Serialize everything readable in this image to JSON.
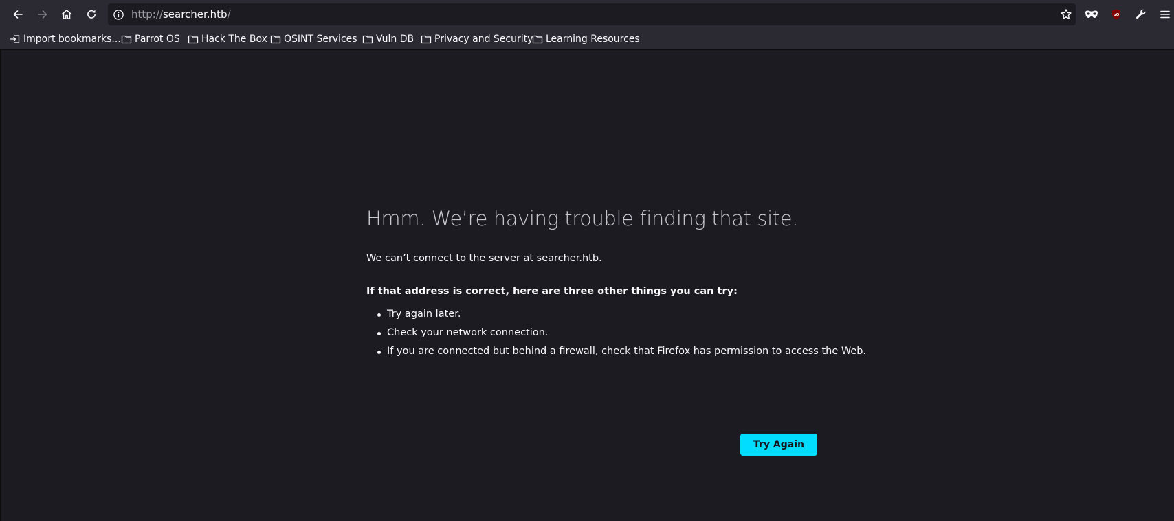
{
  "browser": {
    "url": {
      "scheme": "http://",
      "host": "searcher.htb",
      "path": "/"
    },
    "toolbar_icons": [
      "back-arrow-icon",
      "forward-arrow-icon",
      "home-icon",
      "reload-icon",
      "info-icon",
      "star-icon",
      "private-mask-icon",
      "ublock-icon",
      "wrench-icon",
      "hamburger-menu-icon"
    ],
    "accent_color": "#00ddff"
  },
  "bookmarks": [
    {
      "label": "Import bookmarks...",
      "icon": "import-icon"
    },
    {
      "label": "Parrot OS",
      "icon": "folder-icon"
    },
    {
      "label": "Hack The Box",
      "icon": "folder-icon"
    },
    {
      "label": "OSINT Services",
      "icon": "folder-icon"
    },
    {
      "label": "Vuln DB",
      "icon": "folder-icon"
    },
    {
      "label": "Privacy and Security",
      "icon": "folder-icon"
    },
    {
      "label": "Learning Resources",
      "icon": "folder-icon"
    }
  ],
  "error": {
    "title": "Hmm. We’re having trouble finding that site.",
    "description": "We can’t connect to the server at searcher.htb.",
    "intro": "If that address is correct, here are three other things you can try:",
    "suggestions": [
      "Try again later.",
      "Check your network connection.",
      "If you are connected but behind a firewall, check that Firefox has permission to access the Web."
    ],
    "button_label": "Try Again"
  }
}
